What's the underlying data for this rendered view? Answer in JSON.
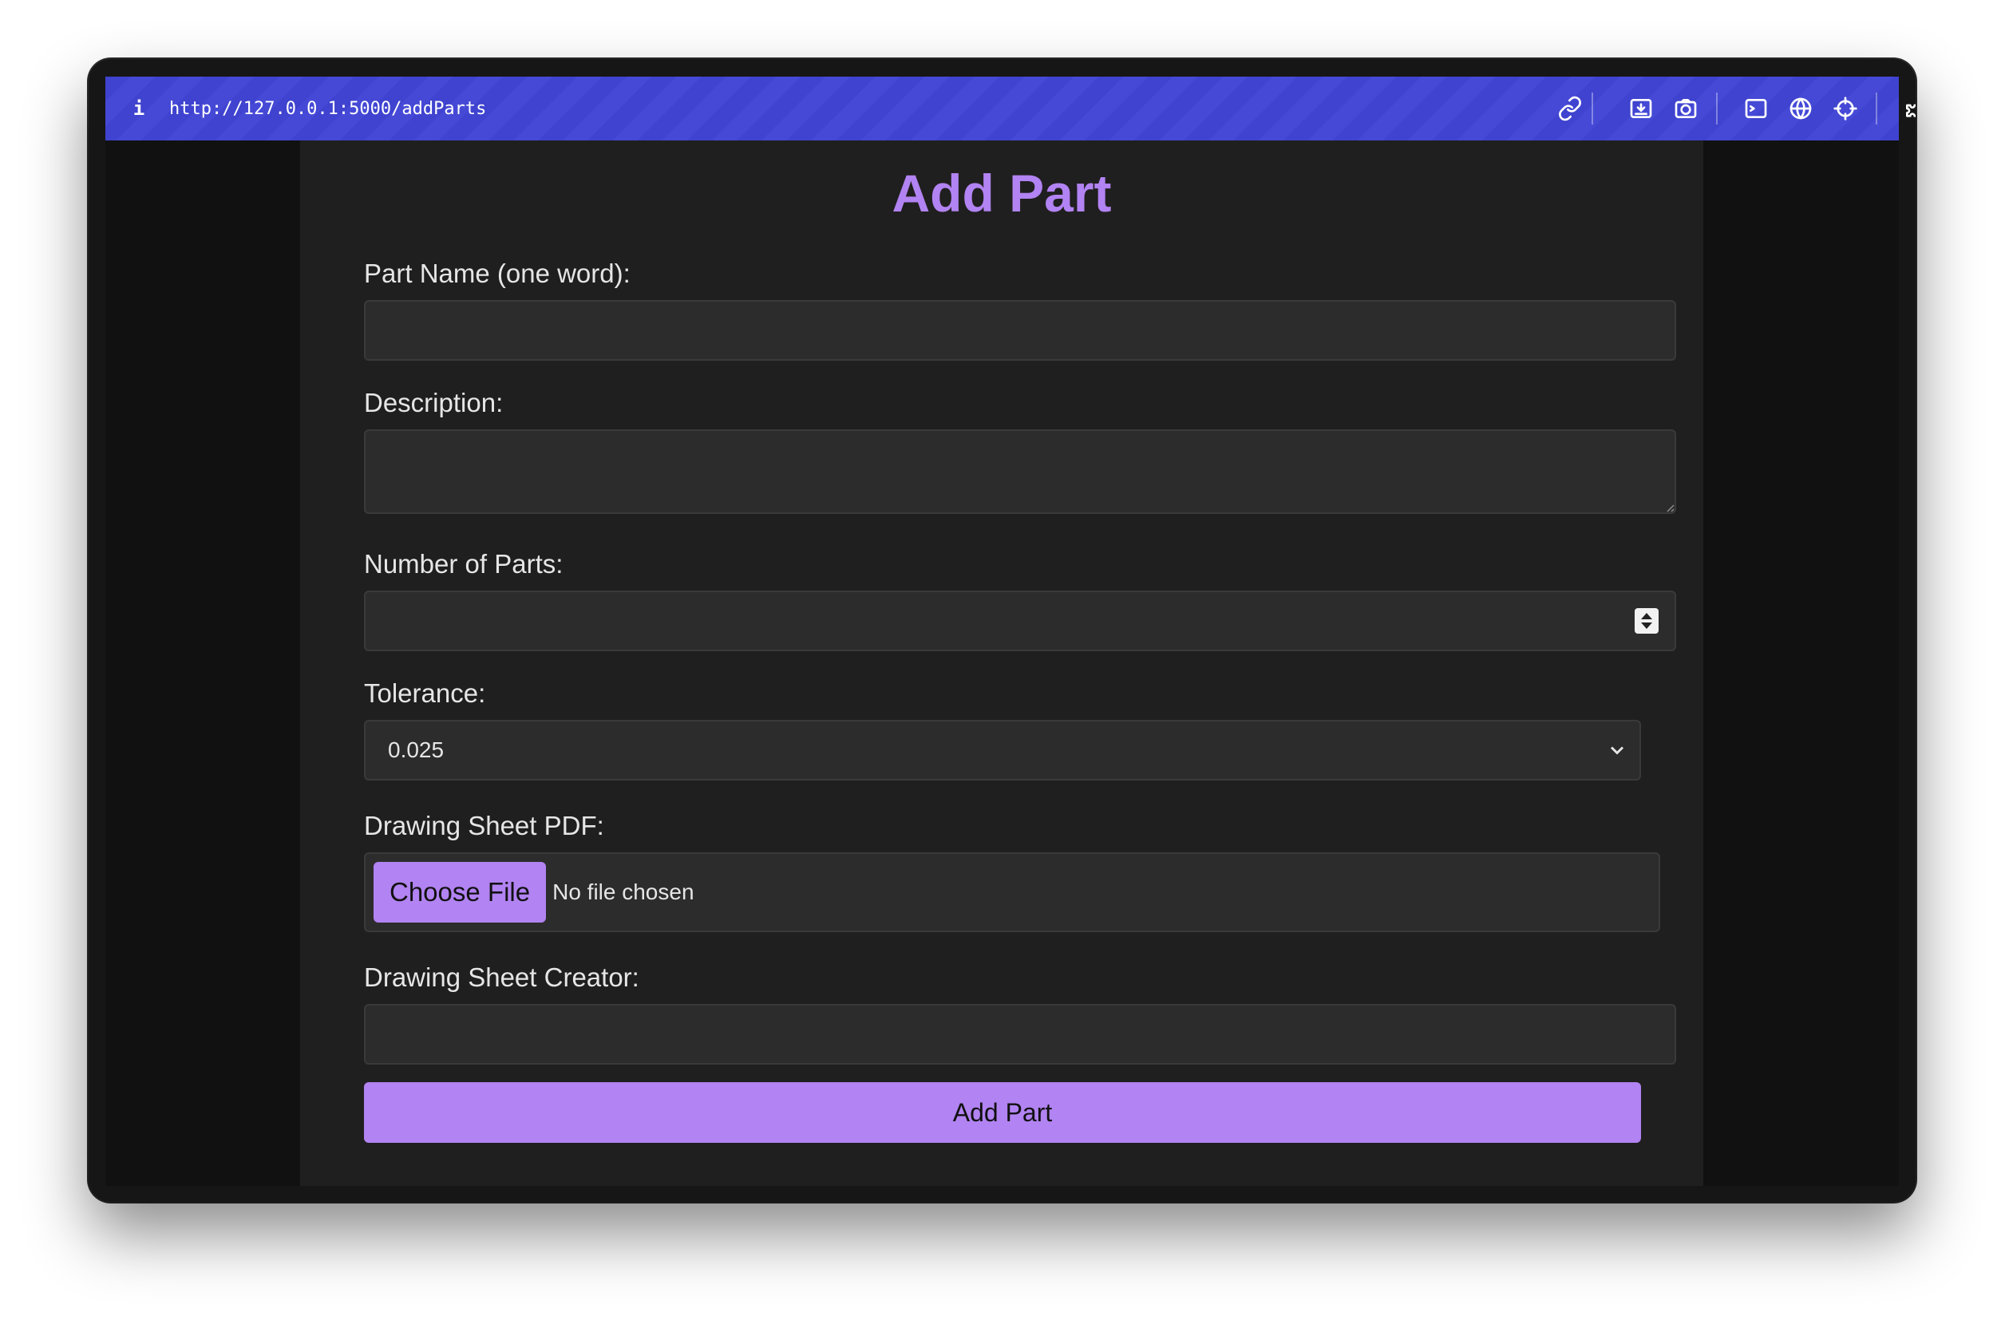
{
  "browser": {
    "url": "http://127.0.0.1:5000/addParts",
    "info_glyph": "i",
    "toolbar_icons": [
      "link-icon",
      "download-icon",
      "camera-icon",
      "terminal-icon",
      "globe-icon",
      "crosshair-icon",
      "puzzle-icon",
      "sidebar-icon"
    ],
    "accent_color": "#3f43cf"
  },
  "form": {
    "title": "Add Part",
    "part_name": {
      "label": "Part Name (one word):",
      "value": ""
    },
    "description": {
      "label": "Description:",
      "value": ""
    },
    "number_of_parts": {
      "label": "Number of Parts:",
      "value": ""
    },
    "tolerance": {
      "label": "Tolerance:",
      "selected": "0.025"
    },
    "drawing_sheet": {
      "label": "Drawing Sheet PDF:",
      "button_label": "Choose File",
      "status": "No file chosen"
    },
    "drawing_creator": {
      "label": "Drawing Sheet Creator:",
      "value": ""
    },
    "submit_label": "Add Part"
  },
  "colors": {
    "accent": "#b283f2",
    "page_bg": "#1f1f1f",
    "input_bg": "#2c2c2c"
  }
}
